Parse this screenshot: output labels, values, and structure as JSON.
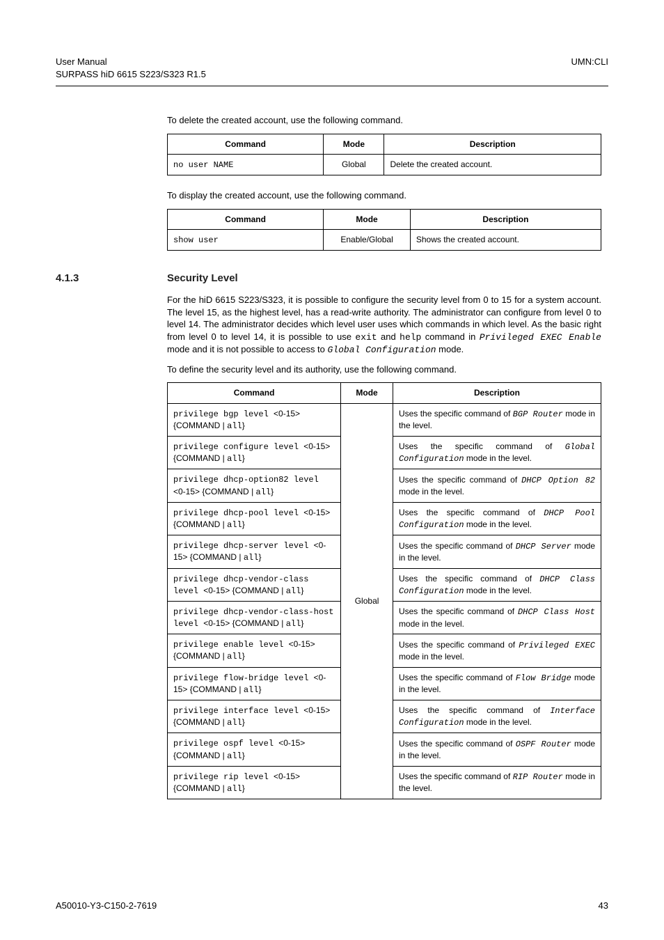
{
  "header": {
    "left_line1": "User Manual",
    "left_line2": "SURPASS hiD 6615 S223/S323 R1.5",
    "right": "UMN:CLI"
  },
  "para_delete": "To delete the created account, use the following command.",
  "table_headers": {
    "command": "Command",
    "mode": "Mode",
    "description": "Description"
  },
  "table_delete": {
    "command": "no user NAME",
    "mode": "Global",
    "description": "Delete the created account."
  },
  "para_display": "To display the created account, use the following command.",
  "table_display": {
    "command": "show user",
    "mode": "Enable/Global",
    "description": "Shows the created account."
  },
  "section": {
    "number": "4.1.3",
    "title": "Security Level"
  },
  "para_security_1a": "For the hiD 6615 S223/S323, it is possible to configure the security level from 0 to 15 for a system account. The level 15, as the highest level, has a read-write authority. The administrator can configure from level 0 to level 14. The administrator decides which level user uses which commands in which level. As the basic right from level 0 to level 14, it is possible to use ",
  "para_security_1b": "exit",
  "para_security_1c": " and ",
  "para_security_1d": "help",
  "para_security_1e": " command in ",
  "para_security_1f": "Privileged EXEC Enable",
  "para_security_1g": " mode and it is not possible to access to ",
  "para_security_1h": "Global Configuration",
  "para_security_1i": " mode.",
  "para_define": "To define the security level and its authority, use the following command.",
  "security_table": {
    "mode": "Global",
    "rows": [
      {
        "cmd_a": "privilege bgp level ",
        "cmd_b": "<0-15>",
        "cmd_c": " {COMMAND ",
        "cmd_d": "| ",
        "cmd_e": "all",
        "cmd_f": "}",
        "desc_a": "Uses the specific command of ",
        "desc_b": "BGP Router",
        "desc_c": " mode in the level."
      },
      {
        "cmd_a": "privilege configure level ",
        "cmd_b": "<0-15>",
        "cmd_c": " {COMMAND ",
        "cmd_d": "| ",
        "cmd_e": "all",
        "cmd_f": "}",
        "desc_a": "Uses the specific command of ",
        "desc_b": "Global Configuration",
        "desc_c": " mode in the level."
      },
      {
        "cmd_a": "privilege dhcp-option82 level ",
        "cmd_b": "<0-15>",
        "cmd_c": " {COMMAND ",
        "cmd_d": "| ",
        "cmd_e": "all",
        "cmd_f": "}",
        "desc_a": "Uses the specific command of ",
        "desc_b": "DHCP Option 82",
        "desc_c": " mode in the level."
      },
      {
        "cmd_a": "privilege dhcp-pool level ",
        "cmd_b": "<0-15> {COMMAND ",
        "cmd_c": "",
        "cmd_d": "| ",
        "cmd_e": "all",
        "cmd_f": "}",
        "desc_a": "Uses the specific command of ",
        "desc_b": "DHCP Pool Configuration",
        "desc_c": " mode in the level."
      },
      {
        "cmd_a": "privilege dhcp-server level ",
        "cmd_b": "<0-15>",
        "cmd_c": " {COMMAND ",
        "cmd_d": "| ",
        "cmd_e": "all",
        "cmd_f": "}",
        "desc_a": "Uses the specific command of ",
        "desc_b": "DHCP Server",
        "desc_c": " mode in the level."
      },
      {
        "cmd_a": "privilege dhcp-vendor-class level ",
        "cmd_b": "<0-15> {COMMAND ",
        "cmd_c": "",
        "cmd_d": "| ",
        "cmd_e": "all",
        "cmd_f": "}",
        "desc_a": "Uses the specific command of ",
        "desc_b": "DHCP Class Configuration",
        "desc_c": " mode in the level."
      },
      {
        "cmd_a": "privilege dhcp-vendor-class-host level ",
        "cmd_b": "<0-15> {COMMAND ",
        "cmd_c": "",
        "cmd_d": "| ",
        "cmd_e": "all",
        "cmd_f": "}",
        "desc_a": "Uses the specific command of ",
        "desc_b": "DHCP Class Host",
        "desc_c": " mode in the level."
      },
      {
        "cmd_a": "privilege enable level ",
        "cmd_b": "<0-15>",
        "cmd_c": " {COMMAND ",
        "cmd_d": "| ",
        "cmd_e": "all",
        "cmd_f": "}",
        "desc_a": "Uses the specific command of ",
        "desc_b": "Privileged EXEC",
        "desc_c": " mode in the level."
      },
      {
        "cmd_a": "privilege flow-bridge level ",
        "cmd_b": "<0-15>",
        "cmd_c": " {COMMAND ",
        "cmd_d": "| ",
        "cmd_e": "all",
        "cmd_f": "}",
        "desc_a": "Uses the specific command of ",
        "desc_b": "Flow Bridge",
        "desc_c": " mode in the level."
      },
      {
        "cmd_a": "privilege interface level ",
        "cmd_b": "<0-15>",
        "cmd_c": " {COMMAND ",
        "cmd_d": "| ",
        "cmd_e": "all",
        "cmd_f": "}",
        "desc_a": "Uses the specific command of ",
        "desc_b": "Interface Configuration",
        "desc_c": " mode in the level."
      },
      {
        "cmd_a": "privilege ospf level ",
        "cmd_b": "<0-15>",
        "cmd_c": " {COMMAND ",
        "cmd_d": "| ",
        "cmd_e": "all",
        "cmd_f": "}",
        "desc_a": "Uses the specific command of ",
        "desc_b": "OSPF Router",
        "desc_c": " mode in the level."
      },
      {
        "cmd_a": "privilege rip level ",
        "cmd_b": "<0-15>",
        "cmd_c": " {COMMAND ",
        "cmd_d": "| ",
        "cmd_e": "all",
        "cmd_f": "}",
        "desc_a": "Uses the specific command of ",
        "desc_b": "RIP Router",
        "desc_c": " mode in the level."
      }
    ]
  },
  "footer": {
    "left": "A50010-Y3-C150-2-7619",
    "right": "43"
  }
}
